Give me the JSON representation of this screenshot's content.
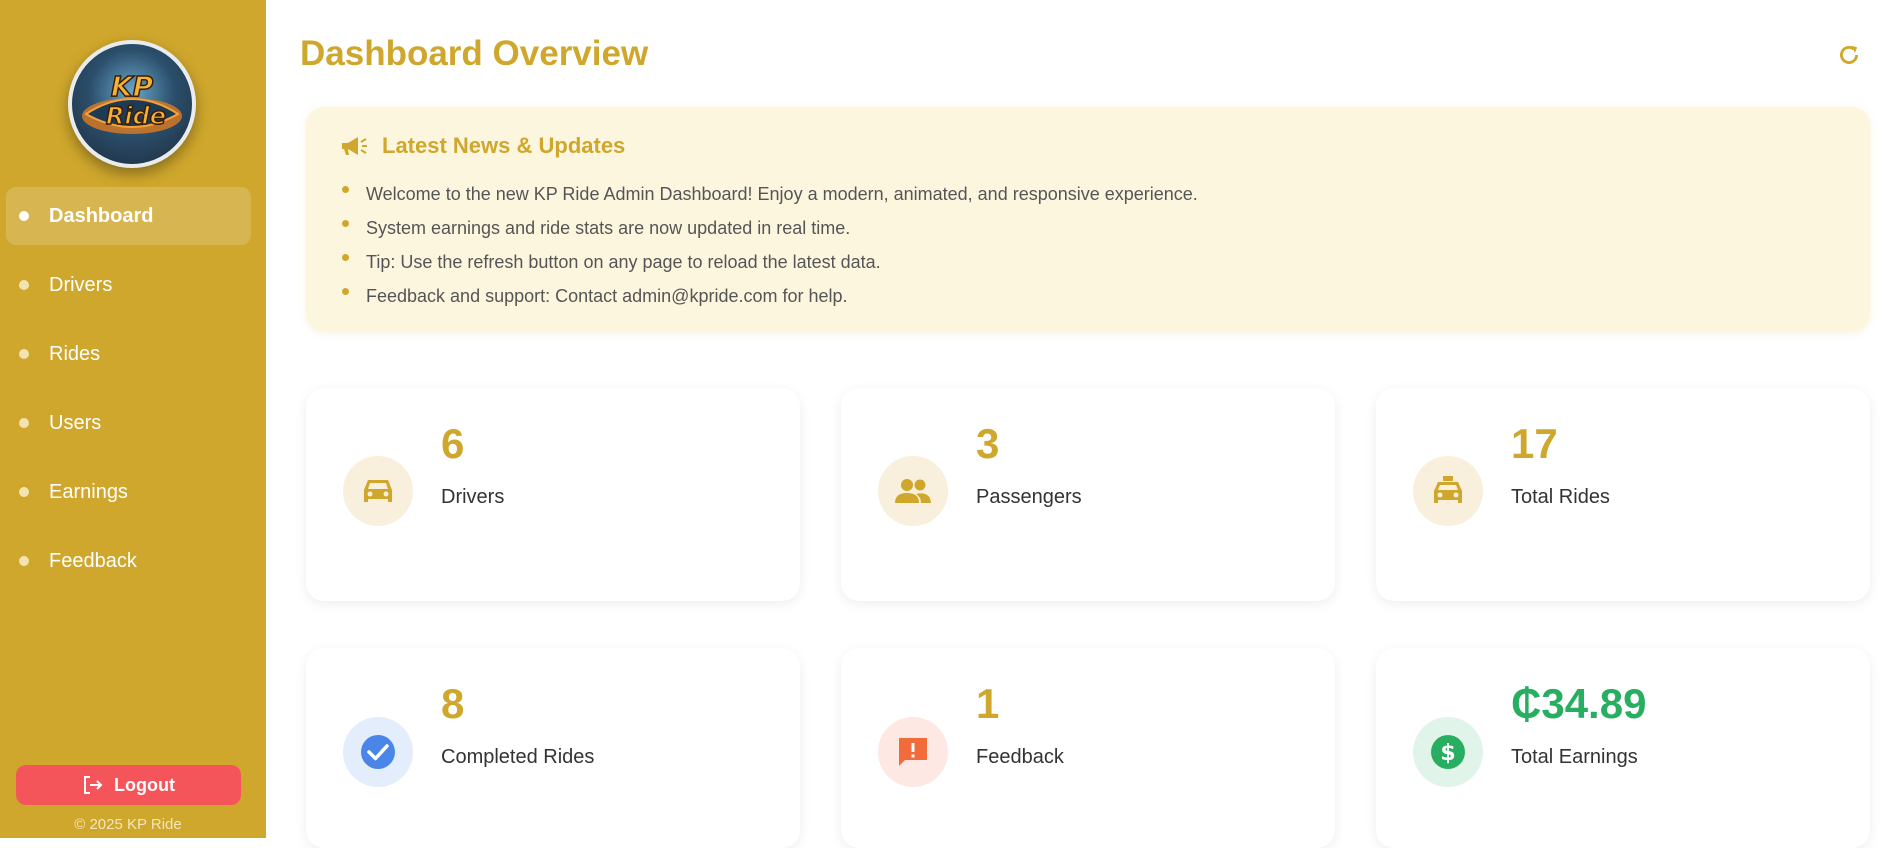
{
  "sidebar": {
    "logo_text": "KP Ride",
    "items": [
      {
        "label": "Dashboard",
        "active": true
      },
      {
        "label": "Drivers",
        "active": false
      },
      {
        "label": "Rides",
        "active": false
      },
      {
        "label": "Users",
        "active": false
      },
      {
        "label": "Earnings",
        "active": false
      },
      {
        "label": "Feedback",
        "active": false
      }
    ],
    "logout_label": "Logout",
    "copyright": "© 2025 KP Ride"
  },
  "header": {
    "title": "Dashboard Overview",
    "refresh_icon": "refresh-icon"
  },
  "news": {
    "icon": "megaphone-icon",
    "title": "Latest News & Updates",
    "items": [
      "Welcome to the new KP Ride Admin Dashboard! Enjoy a modern, animated, and responsive experience.",
      "System earnings and ride stats are now updated in real time.",
      "Tip: Use the refresh button on any page to reload the latest data.",
      "Feedback and support: Contact admin@kpride.com for help."
    ]
  },
  "stats": [
    {
      "value": "6",
      "label": "Drivers",
      "icon": "car-icon"
    },
    {
      "value": "3",
      "label": "Passengers",
      "icon": "people-icon"
    },
    {
      "value": "17",
      "label": "Total Rides",
      "icon": "taxi-icon"
    },
    {
      "value": "8",
      "label": "Completed Rides",
      "icon": "check-circle-icon"
    },
    {
      "value": "1",
      "label": "Feedback",
      "icon": "feedback-icon"
    },
    {
      "value": "₵34.89",
      "label": "Total Earnings",
      "icon": "dollar-icon"
    }
  ],
  "colors": {
    "brand": "#cfa72c",
    "logout": "#f4555a",
    "earnings": "#27ae60",
    "check": "#4a86e8",
    "feedback": "#f26b3a"
  }
}
